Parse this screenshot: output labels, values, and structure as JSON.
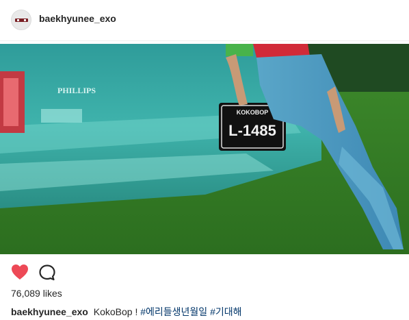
{
  "post": {
    "username": "baekhyunee_exo",
    "photo": {
      "car_badge": "PHILLIPS",
      "plate_top": "KOKOBOP",
      "plate_main": "L-1485"
    },
    "likes_count": "76,089",
    "likes_label": "likes",
    "caption": {
      "username": "baekhyunee_exo",
      "text": "KokoBop !",
      "hashtags": [
        "#에리들생년월일",
        "#기대해"
      ]
    }
  },
  "colors": {
    "heart": "#ed4956",
    "hashtag": "#003569",
    "text": "#262626"
  },
  "icons": {
    "like": "heart-icon",
    "comment": "speech-bubble-icon"
  }
}
